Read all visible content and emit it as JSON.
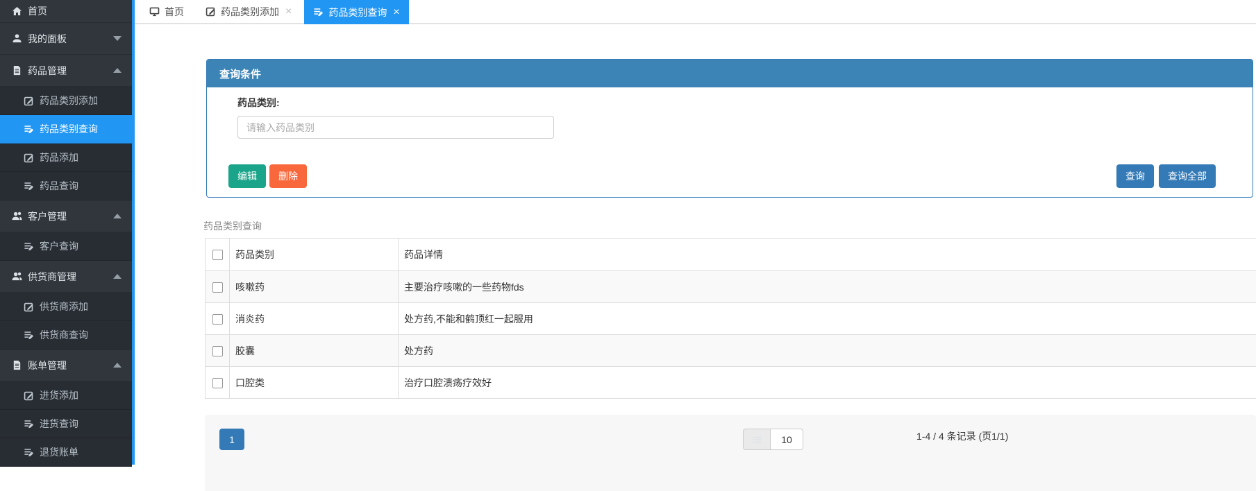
{
  "sidebar": {
    "items": [
      {
        "label": "首页",
        "icon": "home",
        "type": "parent"
      },
      {
        "label": "我的面板",
        "icon": "user",
        "type": "parent",
        "chevron": "down"
      },
      {
        "label": "药品管理",
        "icon": "file",
        "type": "parent",
        "chevron": "up"
      },
      {
        "label": "药品类别添加",
        "icon": "pencil",
        "type": "sub"
      },
      {
        "label": "药品类别查询",
        "icon": "list",
        "type": "sub",
        "active": true
      },
      {
        "label": "药品添加",
        "icon": "pencil",
        "type": "sub"
      },
      {
        "label": "药品查询",
        "icon": "list",
        "type": "sub"
      },
      {
        "label": "客户管理",
        "icon": "users",
        "type": "parent",
        "chevron": "up"
      },
      {
        "label": "客户查询",
        "icon": "list",
        "type": "sub"
      },
      {
        "label": "供货商管理",
        "icon": "users",
        "type": "parent",
        "chevron": "up"
      },
      {
        "label": "供货商添加",
        "icon": "pencil",
        "type": "sub"
      },
      {
        "label": "供货商查询",
        "icon": "list",
        "type": "sub"
      },
      {
        "label": "账单管理",
        "icon": "file",
        "type": "parent",
        "chevron": "up"
      },
      {
        "label": "进货添加",
        "icon": "pencil",
        "type": "sub"
      },
      {
        "label": "进货查询",
        "icon": "list",
        "type": "sub"
      },
      {
        "label": "退货账单",
        "icon": "list",
        "type": "sub"
      }
    ]
  },
  "tabs": [
    {
      "label": "首页",
      "icon": "monitor",
      "closable": false,
      "close_glyph": "×"
    },
    {
      "label": "药品类别添加",
      "icon": "pencil",
      "closable": true,
      "close_glyph": "×"
    },
    {
      "label": "药品类别查询",
      "icon": "list",
      "closable": true,
      "active": true,
      "close_glyph": "×"
    }
  ],
  "query_panel": {
    "title": "查询条件",
    "field_label": "药品类别:",
    "input_value": "",
    "input_placeholder": "请输入药品类别",
    "buttons": {
      "edit": "编辑",
      "delete": "删除",
      "query": "查询",
      "query_all": "查询全部"
    }
  },
  "table": {
    "caption": "药品类别查询",
    "columns": [
      "药品类别",
      "药品详情"
    ],
    "rows": [
      {
        "category": "咳嗽药",
        "detail": "主要治疗咳嗽的一些药物fds"
      },
      {
        "category": "消炎药",
        "detail": "处方药,不能和鹤顶红一起服用"
      },
      {
        "category": "胶囊",
        "detail": "处方药"
      },
      {
        "category": "口腔类",
        "detail": "治疗口腔溃疡疗效好"
      }
    ]
  },
  "pagination": {
    "current_page": "1",
    "page_size": "10",
    "summary": "1-4 / 4 条记录 (页1/1)"
  },
  "colors": {
    "accent_blue": "#2196F3",
    "panel_blue": "#337AB7",
    "header_blue": "#3C84B6",
    "edit_teal": "#1AA489",
    "delete_orange": "#F8683C",
    "sidebar_dark": "#2F353B"
  }
}
